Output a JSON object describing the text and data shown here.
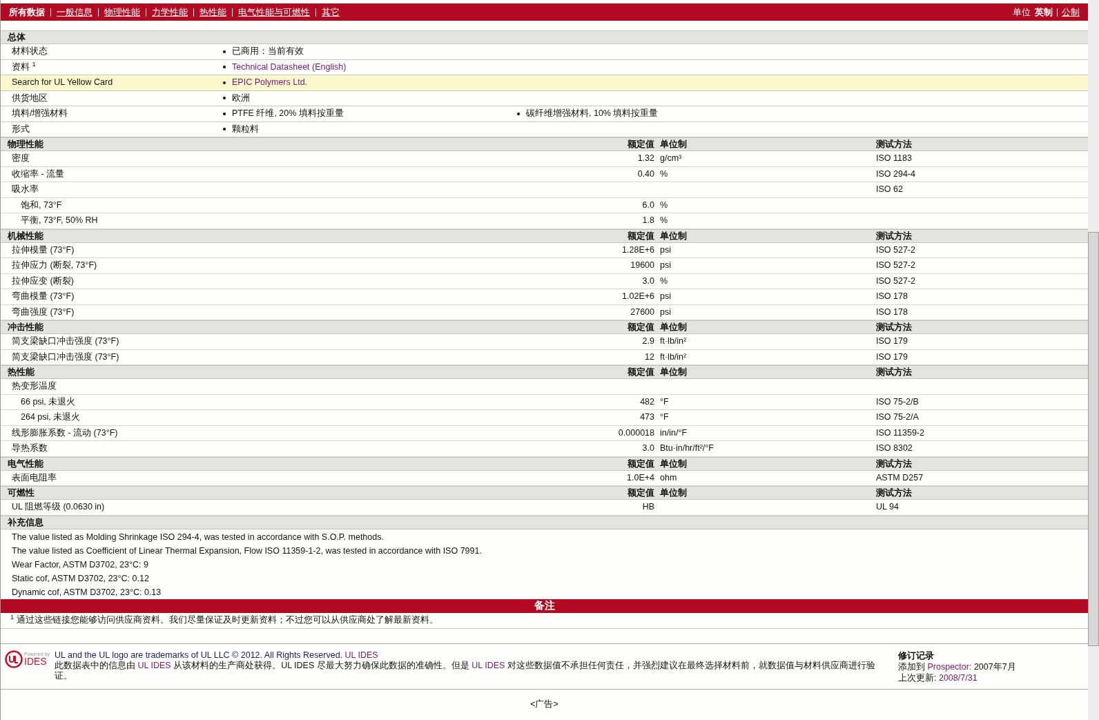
{
  "nav": {
    "tabs": [
      {
        "label": "所有数据",
        "selected": true
      },
      {
        "label": "一般信息",
        "selected": false
      },
      {
        "label": "物理性能",
        "selected": false
      },
      {
        "label": "力学性能",
        "selected": false
      },
      {
        "label": "热性能",
        "selected": false
      },
      {
        "label": "电气性能与可燃性",
        "selected": false
      },
      {
        "label": "其它",
        "selected": false
      }
    ],
    "units": {
      "label": "单位",
      "options": [
        {
          "label": "英制",
          "selected": true
        },
        {
          "label": "公制",
          "selected": false
        }
      ]
    }
  },
  "general": {
    "title": "总体",
    "rows": [
      {
        "label": "材料状态",
        "highlighted": false,
        "values": [
          {
            "text": "已商用：当前有效",
            "kind": "plain"
          }
        ]
      },
      {
        "label": "资料 $^{1}$",
        "highlighted": false,
        "values": [
          {
            "text": "Technical Datasheet (English)",
            "kind": "link"
          }
        ]
      },
      {
        "label": "Search for UL Yellow Card",
        "highlighted": true,
        "values": [
          {
            "text": "EPIC Polymers Ltd.",
            "kind": "link"
          }
        ]
      },
      {
        "label": "供货地区",
        "highlighted": false,
        "values": [
          {
            "text": "欧洲",
            "kind": "plain"
          }
        ]
      },
      {
        "label": "填料/增强材料",
        "highlighted": false,
        "values": [
          {
            "text": "PTFE 纤维, 20% 填料按重量",
            "kind": "plain"
          },
          {
            "text": "碳纤维增强材料, 10% 填料按重量",
            "kind": "plain"
          }
        ]
      },
      {
        "label": "形式",
        "highlighted": false,
        "values": [
          {
            "text": "颗粒料",
            "kind": "plain"
          }
        ]
      }
    ]
  },
  "sections": [
    {
      "title": "物理性能",
      "columns": [
        "额定值",
        "单位制",
        "测试方法"
      ],
      "rows": [
        {
          "label": "密度",
          "value": "1.32",
          "unit": "g/cm³",
          "method": "ISO 1183"
        },
        {
          "label": "收缩率  - 流量",
          "value": "0.40",
          "unit": "%",
          "method": "ISO 294-4"
        },
        {
          "label": "吸水率",
          "method": "ISO 62",
          "children": [
            {
              "label": "饱和, 73°F",
              "value": "6.0",
              "unit": "%"
            },
            {
              "label": "平衡, 73°F, 50% RH",
              "value": "1.8",
              "unit": "%"
            }
          ]
        }
      ]
    },
    {
      "title": "机械性能",
      "columns": [
        "额定值",
        "单位制",
        "测试方法"
      ],
      "rows": [
        {
          "label": "拉伸模量  (73°F)",
          "value": "1.28E+6",
          "unit": "psi",
          "method": "ISO 527-2"
        },
        {
          "label": "拉伸应力  (断裂, 73°F)",
          "value": "19600",
          "unit": "psi",
          "method": "ISO 527-2"
        },
        {
          "label": "拉伸应变  (断裂)",
          "value": "3.0",
          "unit": "%",
          "method": "ISO 527-2"
        },
        {
          "label": "弯曲模量  (73°F)",
          "value": "1.02E+6",
          "unit": "psi",
          "method": "ISO 178"
        },
        {
          "label": "弯曲强度  (73°F)",
          "value": "27600",
          "unit": "psi",
          "method": "ISO 178"
        }
      ]
    },
    {
      "title": "冲击性能",
      "columns": [
        "额定值",
        "单位制",
        "测试方法"
      ],
      "rows": [
        {
          "label": "简支梁缺口冲击强度  (73°F)",
          "value": "2.9",
          "unit": "ft·lb/in²",
          "method": "ISO 179"
        },
        {
          "label": "简支梁缺口冲击强度  (73°F)",
          "value": "12",
          "unit": "ft·lb/in²",
          "method": "ISO 179"
        }
      ]
    },
    {
      "title": "热性能",
      "columns": [
        "额定值",
        "单位制",
        "测试方法"
      ],
      "rows": [
        {
          "label": "热变形温度",
          "children": [
            {
              "label": "66 psi, 未退火",
              "value": "482",
              "unit": "°F",
              "method": "ISO 75-2/B"
            },
            {
              "label": "264 psi, 未退火",
              "value": "473",
              "unit": "°F",
              "method": "ISO 75-2/A"
            }
          ]
        },
        {
          "label": "线形膨胀系数  - 流动  (73°F)",
          "value": "0.000018",
          "unit": "in/in/°F",
          "method": "ISO 11359-2"
        },
        {
          "label": "导热系数",
          "value": "3.0",
          "unit": "Btu·in/hr/ft²/°F",
          "method": "ISO 8302"
        }
      ]
    },
    {
      "title": "电气性能",
      "columns": [
        "额定值",
        "单位制",
        "测试方法"
      ],
      "rows": [
        {
          "label": "表面电阻率",
          "value": "1.0E+4",
          "unit": "ohm",
          "method": "ASTM D257"
        }
      ]
    },
    {
      "title": "可燃性",
      "columns": [
        "额定值",
        "单位制",
        "测试方法"
      ],
      "rows": [
        {
          "label": "UL 阻燃等级  (0.0630 in)",
          "value": "HB",
          "method": "UL 94"
        }
      ]
    }
  ],
  "supplementary": {
    "title": "补充信息",
    "lines": [
      "The value listed as Molding Shrinkage ISO 294-4, was tested in accordance with S.O.P. methods.",
      "The value listed as Coefficient of Linear Thermal Expansion, Flow ISO 11359-1-2, was tested in accordance with ISO 7991.",
      "Wear Factor, ASTM D3702, 23°C: 9",
      "Static cof, ASTM D3702, 23°C: 0.12",
      "Dynamic cof, ASTM D3702, 23°C: 0.13"
    ]
  },
  "notes": {
    "title": "备注",
    "footnote": "$^{1}$ 通过这些链接您能够访问供应商资料。我们尽量保证及时更新资料；不过您可以从供应商处了解最新资料。"
  },
  "footer": {
    "logo": {
      "powered": "Powered by",
      "brand": "IDES"
    },
    "copyright": [
      {
        "text": "UL and the UL logo are trademarks of UL LLC © 2012. All Rights Reserved. ",
        "kind": "plain"
      },
      {
        "text": "UL IDES",
        "kind": "link"
      }
    ],
    "disclaimer": [
      {
        "text": "此数据表中的信息由 ",
        "kind": "plain"
      },
      {
        "text": "UL IDES",
        "kind": "link"
      },
      {
        "text": " 从该材料的生产商处获得。UL IDES 尽最大努力确保此数据的准确性。但是 ",
        "kind": "plain"
      },
      {
        "text": "UL IDES",
        "kind": "link"
      },
      {
        "text": " 对这些数据值不承担任何责任，并强烈建议在最终选择材料前，就数据值与材料供应商进行验证。",
        "kind": "plain"
      }
    ],
    "history": {
      "title": "修订记录",
      "entries": [
        {
          "label": "添加到",
          "link": "Prospector:",
          "value": "2007年7月"
        },
        {
          "label": "上次更新:",
          "value": "2008/7/31"
        }
      ]
    }
  },
  "ad": "<广告>"
}
